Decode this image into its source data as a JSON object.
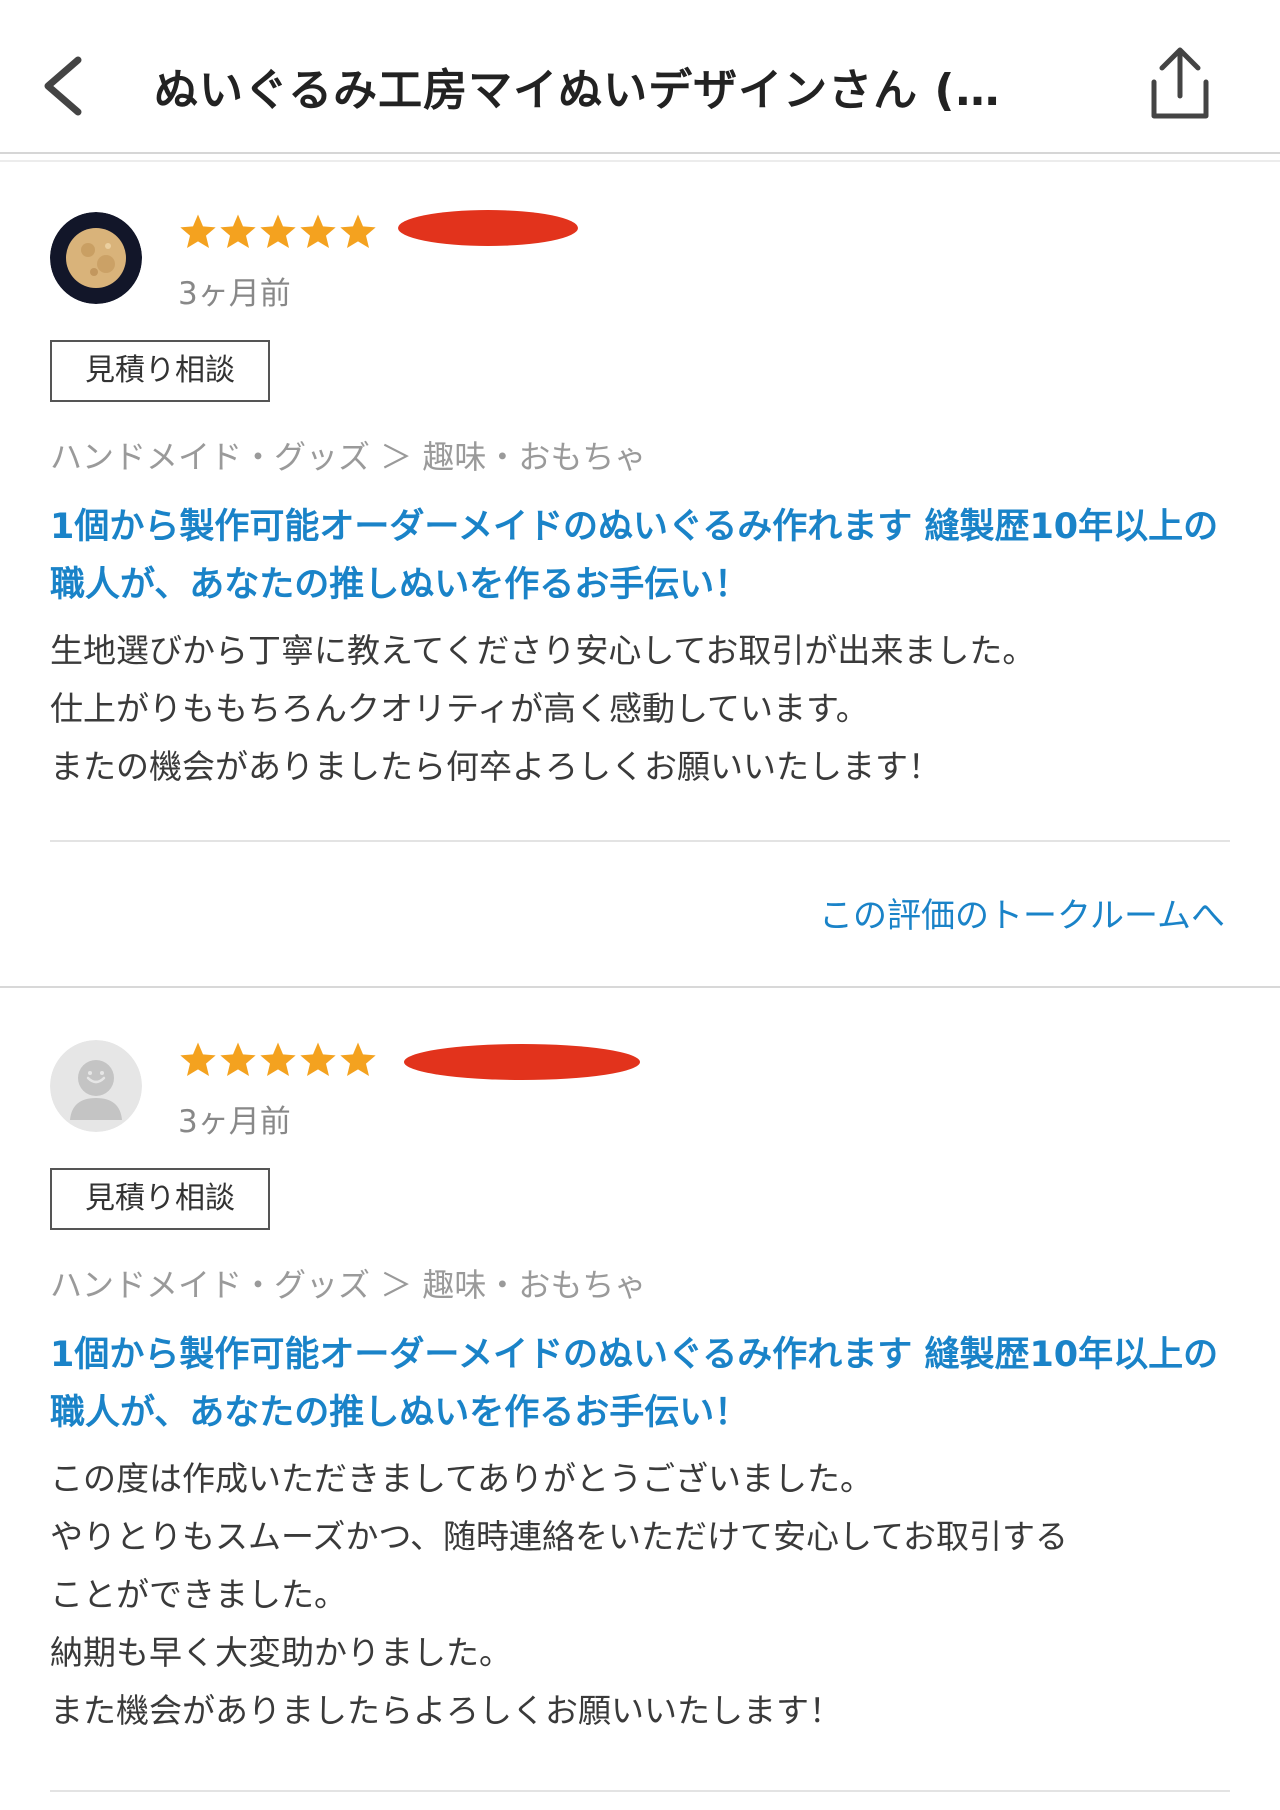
{
  "header": {
    "title": "ぬいぐるみ工房マイぬいデザインさん (…",
    "back_icon": "chevron-left-icon",
    "share_icon": "share-icon"
  },
  "colors": {
    "link_blue": "#1a83c8",
    "star": "#f4a21f",
    "redaction": "#e2331c"
  },
  "reviews": [
    {
      "avatar": "full-moon-avatar",
      "rating": 5,
      "time": "3ヶ月前",
      "tag": "見積り相談",
      "category": "ハンドメイド・グッズ ＞ 趣味・おもちゃ",
      "service_title": "1個から製作可能オーダーメイドのぬいぐるみ作れます 縫製歴10年以上の職人が、あなたの推しぬいを作るお手伝い！",
      "comment_lines": [
        "生地選びから丁寧に教えてくださり安心してお取引が出来ました。",
        "仕上がりももちろんクオリティが高く感動しています。",
        "またの機会がありましたら何卒よろしくお願いいたします！"
      ],
      "talk_link": "この評価のトークルームへ"
    },
    {
      "avatar": "default-user-avatar",
      "rating": 5,
      "time": "3ヶ月前",
      "tag": "見積り相談",
      "category": "ハンドメイド・グッズ ＞ 趣味・おもちゃ",
      "service_title": "1個から製作可能オーダーメイドのぬいぐるみ作れます 縫製歴10年以上の職人が、あなたの推しぬいを作るお手伝い！",
      "comment_lines": [
        "この度は作成いただきましてありがとうございました。",
        "やりとりもスムーズかつ、随時連絡をいただけて安心してお取引する",
        "ことができました。",
        "納期も早く大変助かりました。",
        "また機会がありましたらよろしくお願いいたします！"
      ]
    }
  ]
}
